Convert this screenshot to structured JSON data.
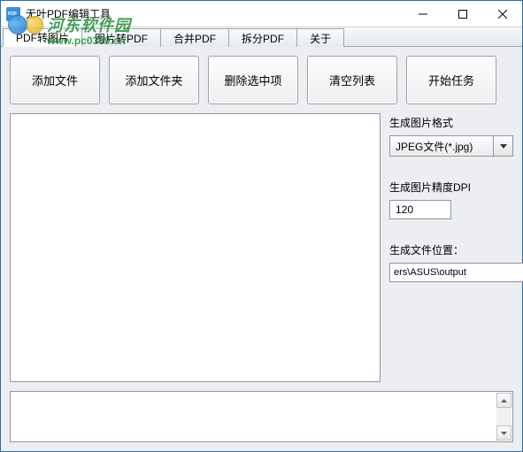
{
  "window": {
    "title": "无叶PDF编辑工具"
  },
  "tabs": [
    {
      "label": "PDF转图片"
    },
    {
      "label": "图片转PDF"
    },
    {
      "label": "合并PDF"
    },
    {
      "label": "拆分PDF"
    },
    {
      "label": "关于"
    }
  ],
  "toolbar": {
    "add_file": "添加文件",
    "add_folder": "添加文件夹",
    "delete_selected": "删除选中项",
    "clear_list": "清空列表",
    "start_task": "开始任务"
  },
  "side": {
    "format_label": "生成图片格式",
    "format_value": "JPEG文件(*.jpg)",
    "dpi_label": "生成图片精度DPI",
    "dpi_value": "120",
    "output_label": "生成文件位置：",
    "output_value": "ers\\ASUS\\output",
    "browse_label": "..."
  },
  "watermark": {
    "brand": "河东软件园",
    "url": "www.pc0359.cn"
  }
}
